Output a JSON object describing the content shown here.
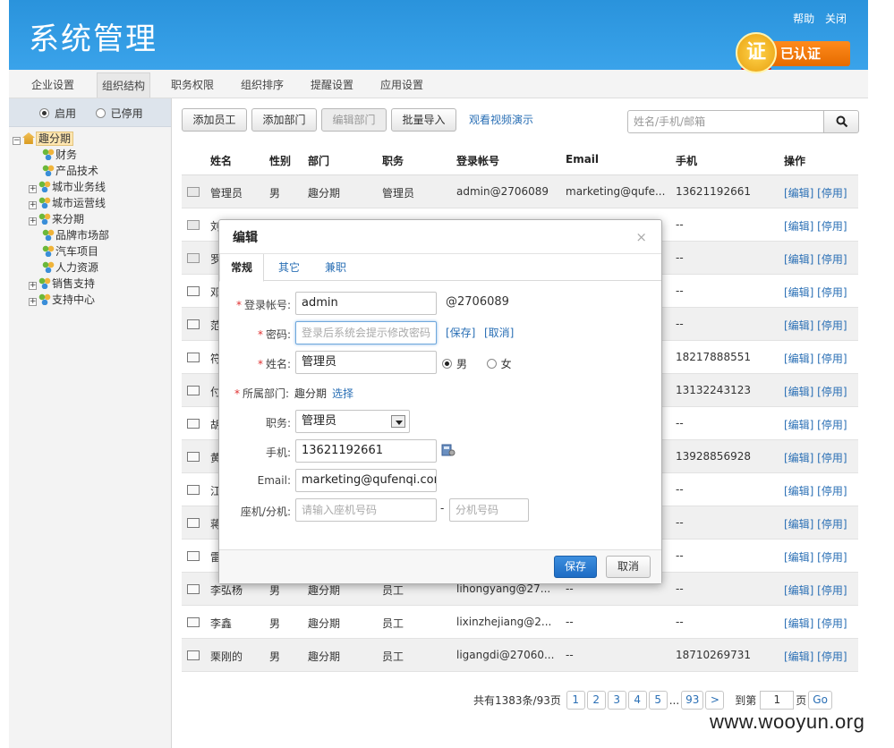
{
  "header": {
    "title": "系统管理",
    "links": [
      "帮助",
      "关闭"
    ],
    "cert_badge": "证",
    "cert_label": "已认证"
  },
  "tabs": [
    "企业设置",
    "组织结构",
    "职务权限",
    "组织排序",
    "提醒设置",
    "应用设置"
  ],
  "sidebar": {
    "filter": [
      "启用",
      "已停用"
    ],
    "tree": [
      {
        "label": "趣分期",
        "level": 0,
        "expander": "⊟"
      },
      {
        "label": "财务",
        "level": 1,
        "expander": ""
      },
      {
        "label": "产品技术",
        "level": 1,
        "expander": ""
      },
      {
        "label": "城市业务线",
        "level": 1,
        "expander": "⊞"
      },
      {
        "label": "城市运营线",
        "level": 1,
        "expander": "⊞"
      },
      {
        "label": "来分期",
        "level": 1,
        "expander": "⊞"
      },
      {
        "label": "品牌市场部",
        "level": 1,
        "expander": ""
      },
      {
        "label": "汽车项目",
        "level": 1,
        "expander": ""
      },
      {
        "label": "人力资源",
        "level": 1,
        "expander": ""
      },
      {
        "label": "销售支持",
        "level": 1,
        "expander": "⊞"
      },
      {
        "label": "支持中心",
        "level": 1,
        "expander": "⊞"
      }
    ]
  },
  "toolbar": {
    "add_employee": "添加员工",
    "add_dept": "添加部门",
    "edit_dept": "编辑部门",
    "batch_import": "批量导入",
    "video_link": "观看视频演示",
    "search_placeholder": "姓名/手机/邮箱"
  },
  "table": {
    "headers": [
      "姓名",
      "性别",
      "部门",
      "职务",
      "登录帐号",
      "Email",
      "手机",
      "操作"
    ],
    "rows": [
      [
        "管理员",
        "男",
        "趣分期",
        "管理员",
        "admin@2706089",
        "marketing@qufe...",
        "13621192661"
      ],
      [
        "刘",
        "",
        "",
        "",
        "",
        "",
        "--"
      ],
      [
        "罗",
        "",
        "",
        "",
        "",
        "",
        "--"
      ],
      [
        "邓",
        "",
        "",
        "",
        "",
        "",
        "--"
      ],
      [
        "范",
        "",
        "",
        "",
        "",
        "",
        "--"
      ],
      [
        "符",
        "",
        "",
        "",
        "",
        "",
        "18217888551"
      ],
      [
        "付",
        "",
        "",
        "",
        "",
        "",
        "13132243123"
      ],
      [
        "胡",
        "",
        "",
        "",
        "",
        "",
        "--"
      ],
      [
        "黄",
        "",
        "",
        "",
        "",
        "",
        "13928856928"
      ],
      [
        "江",
        "",
        "",
        "",
        "",
        "",
        "--"
      ],
      [
        "蒋",
        "",
        "",
        "",
        "",
        "",
        "--"
      ],
      [
        "雷",
        "",
        "",
        "",
        "",
        "",
        "--"
      ],
      [
        "李弘杨",
        "男",
        "趣分期",
        "员工",
        "lihongyang@27...",
        "--",
        "--"
      ],
      [
        "李鑫",
        "男",
        "趣分期",
        "员工",
        "lixinzhejiang@2...",
        "--",
        "--"
      ],
      [
        "栗刚的",
        "男",
        "趣分期",
        "员工",
        "ligangdi@27060...",
        "--",
        "18710269731"
      ]
    ],
    "ops": "[编辑] [停用]"
  },
  "pager": {
    "summary": "共有1383条/93页",
    "pages": [
      "1",
      "2",
      "3",
      "4",
      "5"
    ],
    "ellipsis": "...",
    "last": "93",
    "next": ">",
    "goto_label": "到第",
    "goto_value": "1",
    "page_unit": "页",
    "go": "Go"
  },
  "dialog": {
    "title": "编辑",
    "close": "×",
    "tabs": [
      "常规",
      "其它",
      "兼职"
    ],
    "login_label": "登录帐号:",
    "login_value": "admin",
    "login_suffix": "@2706089",
    "password_label": "密码:",
    "password_placeholder": "登录后系统会提示修改密码",
    "password_save": "[保存]",
    "password_cancel": "[取消]",
    "name_label": "姓名:",
    "name_value": "管理员",
    "gender_male": "男",
    "gender_female": "女",
    "dept_label": "所属部门:",
    "dept_value": "趣分期",
    "dept_select": "选择",
    "position_label": "职务:",
    "position_value": "管理员",
    "mobile_label": "手机:",
    "mobile_value": "13621192661",
    "email_label": "Email:",
    "email_value": "marketing@qufenqi.com",
    "landline_label": "座机/分机:",
    "landline_placeholder": "请输入座机号码",
    "landline_dash": "-",
    "ext_placeholder": "分机号码",
    "save": "保存",
    "cancel": "取消"
  },
  "watermark": "www.wooyun.org"
}
